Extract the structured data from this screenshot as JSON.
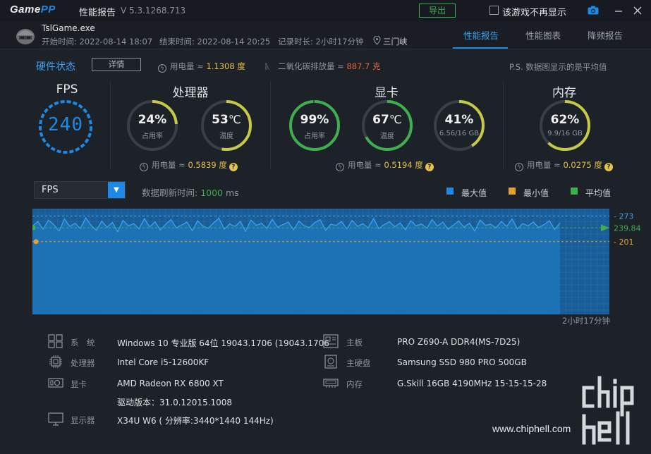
{
  "app": {
    "logo_main": "Game",
    "logo_accent": "PP",
    "title": "性能报告",
    "version": "V 5.3.1268.713",
    "export_label": "导出",
    "dont_show_label": "该游戏不再显示"
  },
  "session": {
    "game": "TslGame.exe",
    "start": "开始时间: 2022-08-14 18:07",
    "end": "结束时间: 2022-08-14 20:25",
    "duration": "记录时长: 2小时17分钟",
    "location": "三门峡",
    "tabs": [
      "性能报告",
      "性能图表",
      "降频报告"
    ]
  },
  "status": {
    "title": "硬件状态",
    "detail_label": "详情",
    "power_label": "用电量 ≈ ",
    "power_value": "1.1308 度",
    "co2_label": "二氧化碳排放量 ≈ ",
    "co2_value": "887.7 克",
    "note": "P.S. 数据图显示的是平均值"
  },
  "fps": {
    "title": "FPS",
    "value": "240"
  },
  "cpu": {
    "title": "处理器",
    "usage": "24%",
    "usage_fraction": 0.24,
    "usage_label": "占用率",
    "temp": "53",
    "temp_unit": "℃",
    "temp_fraction": 0.53,
    "temp_label": "温度",
    "power_label": "用电量 ≈ ",
    "power_value": "0.5839 度"
  },
  "gpu": {
    "title": "显卡",
    "usage": "99%",
    "usage_fraction": 0.99,
    "usage_label": "占用率",
    "temp": "67",
    "temp_unit": "℃",
    "temp_fraction": 0.67,
    "temp_label": "温度",
    "vram": "41%",
    "vram_fraction": 0.41,
    "vram_label": "6.56/16 GB",
    "power_label": "用电量 ≈ ",
    "power_value": "0.5194 度"
  },
  "mem": {
    "title": "内存",
    "usage": "62%",
    "usage_fraction": 0.62,
    "usage_label": "9.9/16 GB",
    "power_label": "用电量 ≈ ",
    "power_value": "0.0275 度"
  },
  "chart_controls": {
    "selected": "FPS",
    "refresh_label": "数据刷新时间: ",
    "refresh_value": "1000",
    "refresh_unit": " ms",
    "legend": [
      {
        "name": "最大值",
        "color": "#1e88e5"
      },
      {
        "name": "最小值",
        "color": "#e5a12b"
      },
      {
        "name": "平均值",
        "color": "#3fae4c"
      }
    ],
    "duration": "2小时17分钟"
  },
  "chart_data": {
    "type": "area",
    "metric": "FPS",
    "max": 273,
    "min": 201,
    "avg": 239.84,
    "max_label": "273",
    "avg_label": "239.84",
    "min_label": "201",
    "ylim": [
      0,
      290
    ],
    "values": [
      245,
      258,
      236,
      262,
      249,
      231,
      265,
      244,
      253,
      238,
      268,
      247,
      233,
      259,
      242,
      255,
      229,
      261,
      246,
      252,
      237,
      266,
      243,
      257,
      234,
      250,
      263,
      240,
      248,
      256,
      232,
      260,
      245,
      239,
      254,
      267,
      236,
      251,
      244,
      258,
      230,
      262,
      247,
      253,
      238,
      264,
      242,
      249,
      256,
      235,
      259,
      246,
      241,
      255,
      263,
      233,
      250,
      247,
      258,
      237,
      261,
      244,
      252,
      240,
      266,
      238,
      249,
      257,
      243,
      254,
      234,
      260,
      246,
      251,
      239,
      263,
      245,
      256,
      236,
      248,
      259,
      242,
      253,
      231,
      262,
      247,
      250,
      240,
      258,
      244,
      265,
      237,
      252,
      246,
      256,
      241,
      249,
      260,
      235,
      254
    ]
  },
  "hardware": {
    "os_key": "系　统",
    "os_val": "Windows 10 专业版 64位   19043.1706 (19043.1706",
    "cpu_key": "处理器",
    "cpu_val": "Intel Core i5-12600KF",
    "gpu_key": "显卡",
    "gpu_val": "AMD Radeon RX 6800 XT",
    "driver_val": "驱动版本：31.0.12015.1008",
    "display_key": "显示器",
    "display_val": "X34U W6 ( 分辨率:3440*1440 144Hz)",
    "board_key": "主板",
    "board_val": "PRO Z690-A DDR4(MS-7D25)",
    "disk_key": "主硬盘",
    "disk_val": "Samsung SSD 980 PRO 500GB",
    "ram_key": "内存",
    "ram_val": "G.Skill 16GB 4190MHz 15-15-15-28"
  },
  "watermark": {
    "url": "www.chiphell.com"
  }
}
